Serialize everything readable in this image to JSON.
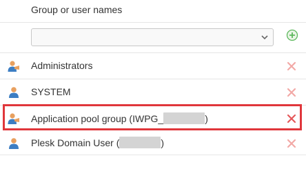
{
  "header": {
    "column_title": "Group or user names"
  },
  "add_select": {
    "value": ""
  },
  "principals": [
    {
      "icon": "group-user-icon",
      "label": "Administrators",
      "suffix": "",
      "masked": false
    },
    {
      "icon": "user-icon",
      "label": "SYSTEM",
      "suffix": "",
      "masked": false
    },
    {
      "icon": "group-user-icon",
      "label": "Application pool group (IWPG_",
      "suffix": ")",
      "masked": true
    },
    {
      "icon": "user-icon",
      "label": "Plesk Domain User (",
      "suffix": ")",
      "masked": true
    }
  ],
  "colors": {
    "remove_x": "#f2a9a6",
    "remove_x_active": "#e5585a",
    "highlight_border": "#e0363b",
    "add_circle": "#5cb85c",
    "person_blue": "#3d7ec3",
    "person_skin": "#e8a05f"
  }
}
